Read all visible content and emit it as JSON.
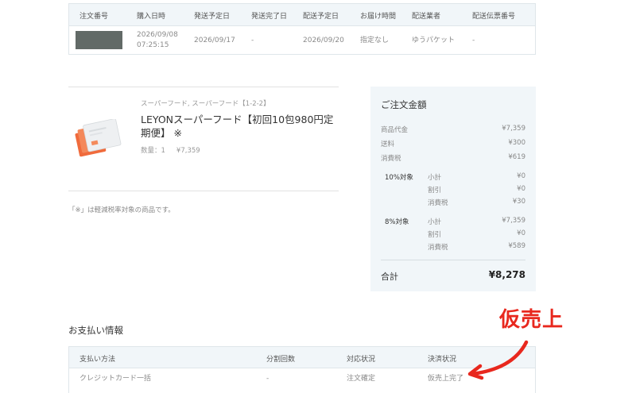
{
  "shipping_table": {
    "headers": [
      "注文番号",
      "購入日時",
      "発送予定日",
      "発送完了日",
      "配送予定日",
      "お届け時間",
      "配送業者",
      "配送伝票番号"
    ],
    "row": {
      "purchase_date": "2026/09/08",
      "purchase_time": "07:25:15",
      "ship_scheduled": "2026/09/17",
      "ship_completed": "-",
      "delivery_scheduled": "2026/09/20",
      "delivery_time": "指定なし",
      "carrier": "ゆうパケット",
      "tracking_no": "-"
    }
  },
  "product": {
    "category": "スーパーフード, スーパーフード【1-2-2】",
    "name": "LEYONスーパーフード【初回10包980円定期便】 ※",
    "qty_label": "数量：1",
    "price": "¥7,359"
  },
  "tax_note": "「※」は軽減税率対象の商品です。",
  "summary": {
    "title": "ご注文金額",
    "rows": [
      {
        "label": "商品代金",
        "value": "¥7,359"
      },
      {
        "label": "送料",
        "value": "¥300"
      },
      {
        "label": "消費税",
        "value": "¥619"
      }
    ],
    "groups": [
      {
        "name": "10%対象",
        "rows": [
          {
            "label": "小計",
            "value": "¥0"
          },
          {
            "label": "割引",
            "value": "¥0"
          },
          {
            "label": "消費税",
            "value": "¥30"
          }
        ]
      },
      {
        "name": "8%対象",
        "rows": [
          {
            "label": "小計",
            "value": "¥7,359"
          },
          {
            "label": "割引",
            "value": "¥0"
          },
          {
            "label": "消費税",
            "value": "¥589"
          }
        ]
      }
    ],
    "total_label": "合計",
    "total_value": "¥8,278"
  },
  "payment": {
    "title": "お支払い情報",
    "headers": [
      "支払い方法",
      "分割回数",
      "対応状況",
      "決済状況"
    ],
    "row": {
      "method": "クレジットカード一括",
      "installments": "-",
      "handling": "注文確定",
      "settlement": "仮売上完了"
    }
  },
  "annotation": {
    "text": "仮売上",
    "color": "#e8281e"
  },
  "colors": {
    "header_bg": "#f1f6f9",
    "summary_bg": "#f1f6f9",
    "border": "#dfe6ea",
    "order_no_mask": "#626a67"
  },
  "icons": {
    "product_image": "product-package-image",
    "annotation_arrow": "arrow-icon"
  }
}
